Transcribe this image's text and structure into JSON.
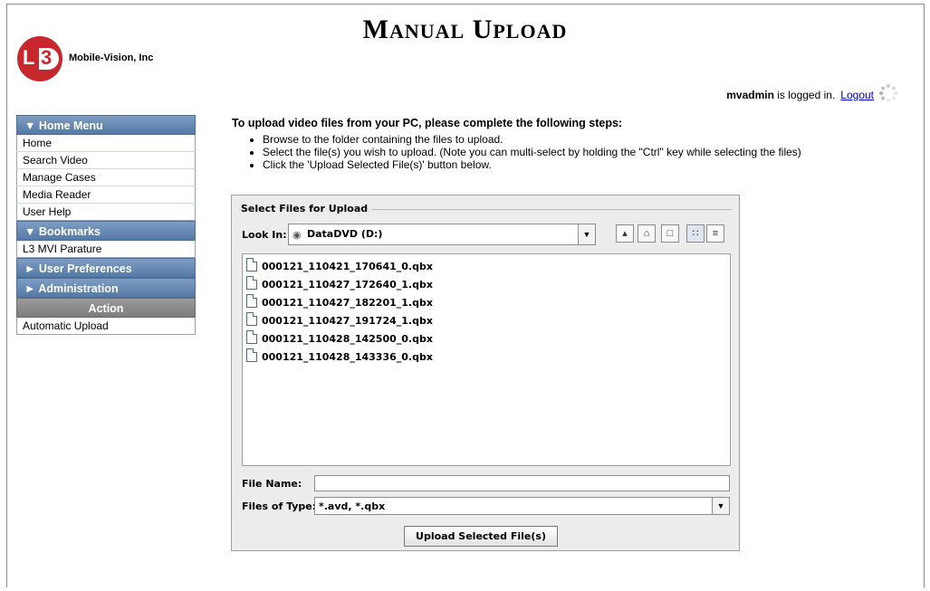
{
  "header": {
    "title_first_initial": "M",
    "title_first_rest": "ANUAL",
    "title_second_initial": "U",
    "title_second_rest": "PLOAD",
    "company": "Mobile-Vision, Inc",
    "logo_text_l": "L",
    "logo_text_3": "3",
    "user": "mvadmin",
    "login_suffix": " is logged in.",
    "logout_label": "Logout"
  },
  "sidebar": {
    "home_menu": {
      "label": "▼  Home Menu",
      "items": [
        "Home",
        "Search Video",
        "Manage Cases",
        "Media Reader",
        "User Help"
      ]
    },
    "bookmarks": {
      "label": "▼  Bookmarks",
      "items": [
        "L3 MVI Parature"
      ]
    },
    "user_preferences": {
      "label": "►  User Preferences"
    },
    "administration": {
      "label": "►  Administration"
    },
    "action": {
      "label": "Action",
      "items": [
        "Automatic Upload"
      ]
    }
  },
  "instructions": {
    "heading": "To upload video files from your PC, please complete the following steps:",
    "steps": [
      "Browse to the folder containing the files to upload.",
      "Select the file(s) you wish to upload. (Note you can multi-select by holding the \"Ctrl\" key while selecting the files)",
      "Click the 'Upload Selected File(s)' button below."
    ]
  },
  "chooser": {
    "group_label": "Select Files for Upload",
    "look_in_label": "Look In:",
    "look_in_value": "DataDVD (D:)",
    "files": [
      "000121_110421_170641_0.qbx",
      "000121_110427_172640_1.qbx",
      "000121_110427_182201_1.qbx",
      "000121_110427_191724_1.qbx",
      "000121_110428_142500_0.qbx",
      "000121_110428_143336_0.qbx"
    ],
    "file_name_label": "File Name:",
    "file_name_value": "",
    "files_of_type_label": "Files of Type:",
    "files_of_type_value": "*.avd, *.qbx",
    "upload_button": "Upload Selected File(s)"
  },
  "colors": {
    "menu_header": "#5b7fab",
    "action_header": "#858585",
    "logo_red": "#c6282d",
    "link": "#0000cc"
  }
}
